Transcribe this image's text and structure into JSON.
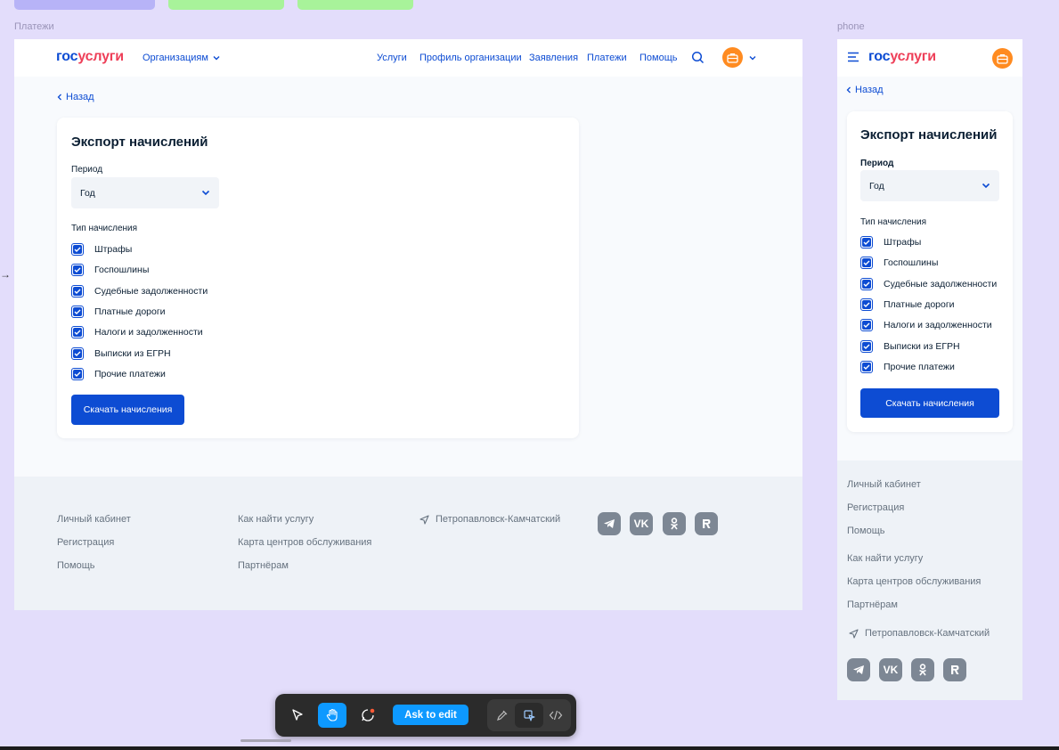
{
  "canvas": {
    "frame_desktop_label": "Платежи",
    "frame_phone_label": "phone",
    "arrow": "→"
  },
  "header": {
    "logo_part1": "гос",
    "logo_part2": "услуги",
    "org_menu": "Организациям",
    "nav": [
      "Услуги",
      "Профиль организации",
      "Заявления",
      "Платежи",
      "Помощь"
    ]
  },
  "back_label": "Назад",
  "form": {
    "title": "Экспорт начислений",
    "period_label": "Период",
    "period_value": "Год",
    "type_label": "Тип начисления",
    "options": [
      {
        "label": "Штрафы",
        "checked": true
      },
      {
        "label": "Госпошлины",
        "checked": true
      },
      {
        "label": "Судебные задолженности",
        "checked": true
      },
      {
        "label": "Платные дороги",
        "checked": true
      },
      {
        "label": "Налоги и задолженности",
        "checked": true
      },
      {
        "label": "Выписки из ЕГРН",
        "checked": true
      },
      {
        "label": "Прочие платежи",
        "checked": true
      }
    ],
    "submit_label": "Скачать начисления"
  },
  "footer": {
    "col1": [
      "Личный кабинет",
      "Регистрация",
      "Помощь"
    ],
    "col2": [
      "Как найти услугу",
      "Карта центров обслуживания",
      "Партнёрам"
    ],
    "location": "Петропавловск-Камчатский",
    "social": [
      "telegram-icon",
      "vk-icon",
      "odnoklassniki-icon",
      "rutube-icon"
    ]
  },
  "toolbar": {
    "ask_label": "Ask to edit"
  },
  "colors": {
    "brand_blue": "#0d4cd3",
    "brand_red": "#ee3f58",
    "avatar_orange": "#ff8b20",
    "canvas_bg": "#e3ddfb",
    "ask_blue": "#0d99ff"
  }
}
